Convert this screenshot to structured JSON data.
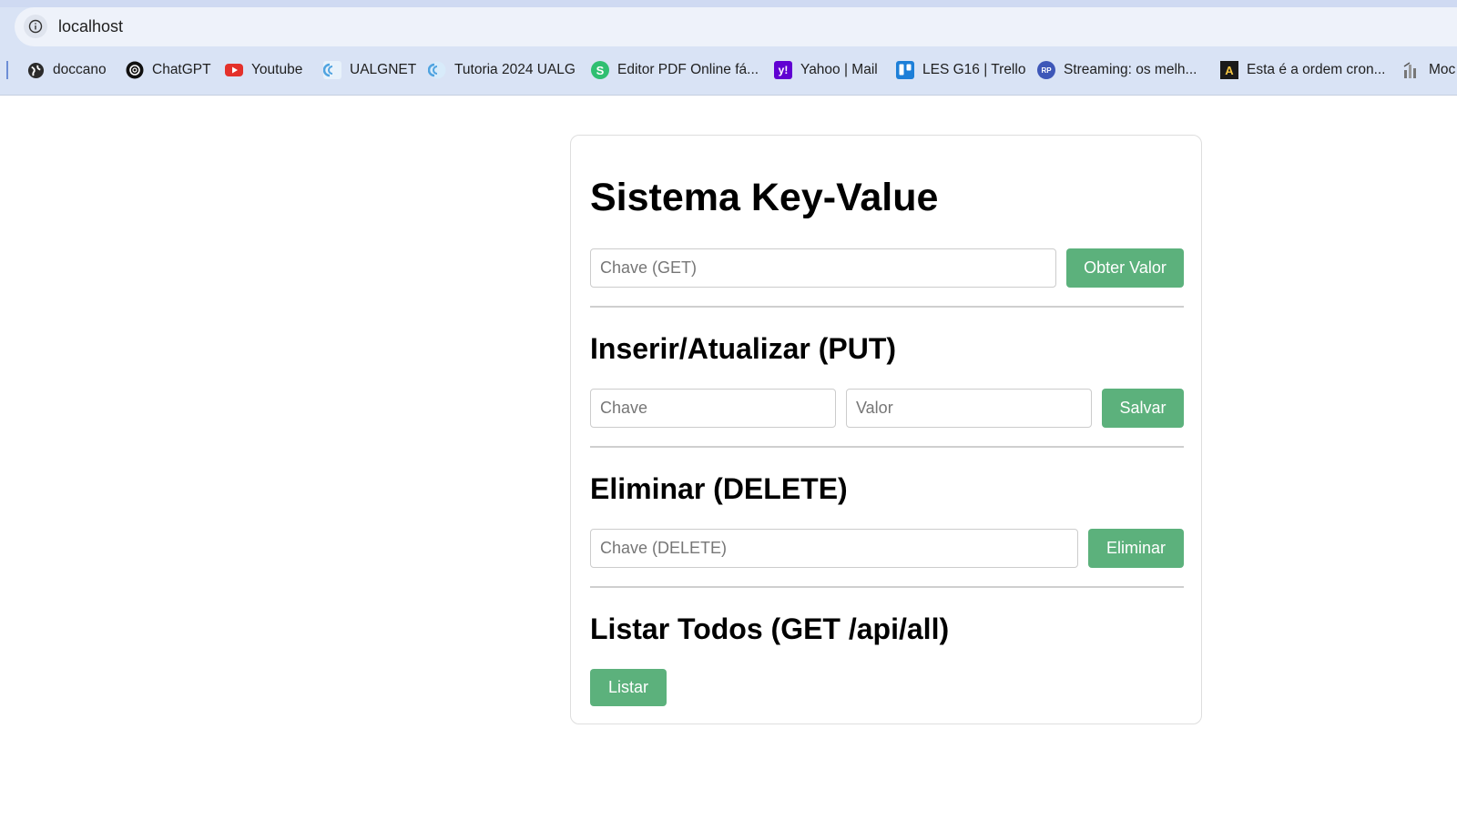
{
  "browser": {
    "url": "localhost",
    "bookmarks": [
      {
        "label": "doccano",
        "icon": "globe-icon",
        "color": "#2b2b2b"
      },
      {
        "label": "ChatGPT",
        "icon": "chatgpt-icon",
        "color": "#111111"
      },
      {
        "label": "Youtube",
        "icon": "youtube-icon",
        "color": "#e4312b"
      },
      {
        "label": "UALGNET",
        "icon": "ualg-icon",
        "color": "#4fa3e0"
      },
      {
        "label": "Tutoria 2024 UALG",
        "icon": "ualg-icon",
        "color": "#4fa3e0"
      },
      {
        "label": "Editor PDF Online fá...",
        "icon": "pdf-editor-icon",
        "color": "#2fbf71"
      },
      {
        "label": "Yahoo | Mail",
        "icon": "yahoo-icon",
        "color": "#6001d2"
      },
      {
        "label": "LES G16 | Trello",
        "icon": "trello-icon",
        "color": "#1d7fd8"
      },
      {
        "label": "Streaming: os melh...",
        "icon": "rp-icon",
        "color": "#3e57b8"
      },
      {
        "label": "Esta é a ordem cron...",
        "icon": "a-icon",
        "color": "#1a1a1a"
      },
      {
        "label": "Moc",
        "icon": "chart-icon",
        "color": "#777777"
      }
    ]
  },
  "page": {
    "title": "Sistema Key-Value",
    "get": {
      "placeholder": "Chave (GET)",
      "button": "Obter Valor"
    },
    "put": {
      "heading": "Inserir/Atualizar (PUT)",
      "key_placeholder": "Chave",
      "value_placeholder": "Valor",
      "button": "Salvar"
    },
    "delete": {
      "heading": "Eliminar (DELETE)",
      "placeholder": "Chave (DELETE)",
      "button": "Eliminar"
    },
    "list": {
      "heading": "Listar Todos (GET /api/all)",
      "button": "Listar"
    }
  },
  "colors": {
    "accent": "#5cb17c"
  }
}
